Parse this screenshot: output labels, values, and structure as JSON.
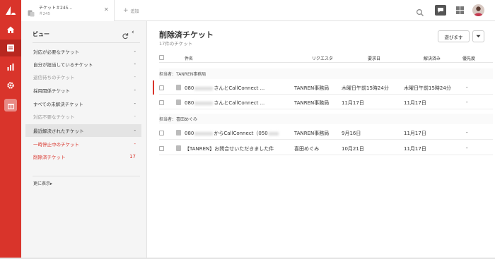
{
  "tab": {
    "title": "チケット＃245...",
    "sub": "＃245",
    "close": "✕"
  },
  "add_tab": {
    "label": "追加"
  },
  "views": {
    "title": "ビュー",
    "items": [
      {
        "label": "対応が必要なチケット",
        "count": "-"
      },
      {
        "label": "自分が担当しているチケット",
        "count": "-"
      },
      {
        "label": "返信待ちのチケット",
        "count": "-"
      },
      {
        "label": "採用関係チケット",
        "count": "-"
      },
      {
        "label": "すべての未解決チケット",
        "count": "-"
      },
      {
        "label": "対応不要なチケット",
        "count": "-"
      },
      {
        "label": "最近解決されたチケット",
        "count": "-"
      },
      {
        "label": "一時停止中のチケット",
        "count": "-"
      },
      {
        "label": "削除済チケット",
        "count": "17"
      }
    ],
    "show_more": "更に表示▸"
  },
  "main": {
    "title": "削除済チケット",
    "subtitle": "17件のチケット",
    "play_button": "遊びます",
    "columns": {
      "subject": "件名",
      "requester": "リクエスタ",
      "requested": "要求日",
      "solved": "解決済み",
      "priority": "優先度"
    },
    "groups": [
      {
        "label": "担当者：TANREN事務局",
        "rows": [
          {
            "subject_prefix": "080",
            "subject_suffix": "さんとCallConnect ...",
            "requester": "TANREN事務局",
            "requested": "木曜日午前15時24分",
            "solved": "木曜日午前15時24分",
            "priority": "-"
          },
          {
            "subject_prefix": "080",
            "subject_suffix": "さんとCallConnect ...",
            "requester": "TANREN事務局",
            "requested": "11月17日",
            "solved": "11月17日",
            "priority": "-"
          }
        ]
      },
      {
        "label": "担当者：喜田めぐみ",
        "rows": [
          {
            "subject_prefix": "080",
            "subject_suffix": "からCallConnect（050",
            "requester": "TANREN事務局",
            "requested": "9月16日",
            "solved": "11月17日",
            "priority": "-"
          },
          {
            "subject_prefix": "",
            "subject_suffix": "【TANREN】お問合せいただきました件",
            "requester": "喜田めぐみ",
            "requested": "10月21日",
            "solved": "11月17日",
            "priority": "-"
          }
        ]
      }
    ]
  },
  "colors": {
    "brand_red": "#d9342b",
    "rail_active": "#b8271f"
  },
  "icons": [
    "zendesk-logo-icon",
    "home-icon",
    "views-icon",
    "reporting-icon",
    "settings-icon",
    "gift-icon",
    "search-icon",
    "chat-icon",
    "apps-grid-icon",
    "refresh-icon",
    "collapse-icon",
    "chevron-down-icon",
    "ticket-icon"
  ]
}
